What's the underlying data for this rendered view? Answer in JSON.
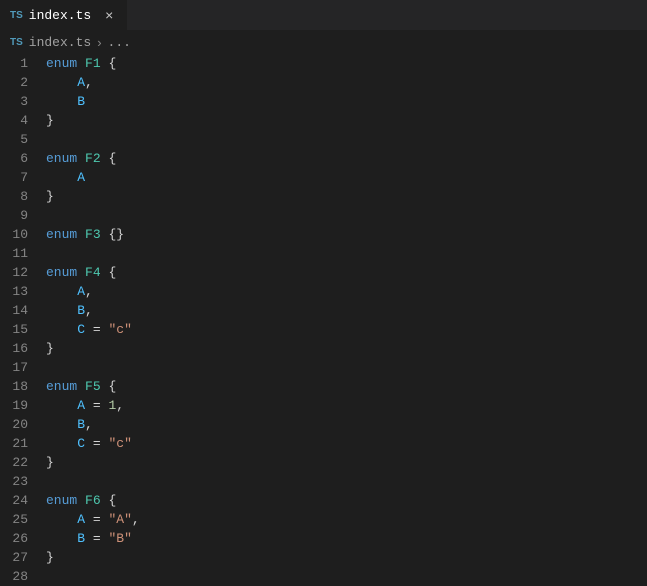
{
  "tab": {
    "icon": "TS",
    "filename": "index.ts",
    "close": "×"
  },
  "breadcrumb": {
    "icon": "TS",
    "filename": "index.ts",
    "sep": "›",
    "more": "..."
  },
  "code": {
    "lines": [
      {
        "n": "1",
        "t": [
          [
            "kw",
            "enum"
          ],
          [
            "sp",
            " "
          ],
          [
            "type",
            "F1"
          ],
          [
            "sp",
            " "
          ],
          [
            "punc",
            "{"
          ]
        ]
      },
      {
        "n": "2",
        "t": [
          [
            "indent",
            "    "
          ],
          [
            "member",
            "A"
          ],
          [
            "punc",
            ","
          ]
        ]
      },
      {
        "n": "3",
        "t": [
          [
            "indent",
            "    "
          ],
          [
            "member",
            "B"
          ]
        ]
      },
      {
        "n": "4",
        "t": [
          [
            "punc",
            "}"
          ]
        ]
      },
      {
        "n": "5",
        "t": []
      },
      {
        "n": "6",
        "t": [
          [
            "kw",
            "enum"
          ],
          [
            "sp",
            " "
          ],
          [
            "type",
            "F2"
          ],
          [
            "sp",
            " "
          ],
          [
            "punc",
            "{"
          ]
        ]
      },
      {
        "n": "7",
        "t": [
          [
            "indent",
            "    "
          ],
          [
            "member",
            "A"
          ]
        ]
      },
      {
        "n": "8",
        "t": [
          [
            "punc",
            "}"
          ]
        ]
      },
      {
        "n": "9",
        "t": []
      },
      {
        "n": "10",
        "t": [
          [
            "kw",
            "enum"
          ],
          [
            "sp",
            " "
          ],
          [
            "type",
            "F3"
          ],
          [
            "sp",
            " "
          ],
          [
            "punc",
            "{}"
          ]
        ]
      },
      {
        "n": "11",
        "t": []
      },
      {
        "n": "12",
        "t": [
          [
            "kw",
            "enum"
          ],
          [
            "sp",
            " "
          ],
          [
            "type",
            "F4"
          ],
          [
            "sp",
            " "
          ],
          [
            "punc",
            "{"
          ]
        ]
      },
      {
        "n": "13",
        "t": [
          [
            "indent",
            "    "
          ],
          [
            "member",
            "A"
          ],
          [
            "punc",
            ","
          ]
        ]
      },
      {
        "n": "14",
        "t": [
          [
            "indent",
            "    "
          ],
          [
            "member",
            "B"
          ],
          [
            "punc",
            ","
          ]
        ]
      },
      {
        "n": "15",
        "t": [
          [
            "indent",
            "    "
          ],
          [
            "member",
            "C"
          ],
          [
            "sp",
            " "
          ],
          [
            "punc",
            "="
          ],
          [
            "sp",
            " "
          ],
          [
            "str",
            "\"c\""
          ]
        ]
      },
      {
        "n": "16",
        "t": [
          [
            "punc",
            "}"
          ]
        ]
      },
      {
        "n": "17",
        "t": []
      },
      {
        "n": "18",
        "t": [
          [
            "kw",
            "enum"
          ],
          [
            "sp",
            " "
          ],
          [
            "type",
            "F5"
          ],
          [
            "sp",
            " "
          ],
          [
            "punc",
            "{"
          ]
        ]
      },
      {
        "n": "19",
        "t": [
          [
            "indent",
            "    "
          ],
          [
            "member",
            "A"
          ],
          [
            "sp",
            " "
          ],
          [
            "punc",
            "="
          ],
          [
            "sp",
            " "
          ],
          [
            "num",
            "1"
          ],
          [
            "punc",
            ","
          ]
        ]
      },
      {
        "n": "20",
        "t": [
          [
            "indent",
            "    "
          ],
          [
            "member",
            "B"
          ],
          [
            "punc",
            ","
          ]
        ]
      },
      {
        "n": "21",
        "t": [
          [
            "indent",
            "    "
          ],
          [
            "member",
            "C"
          ],
          [
            "sp",
            " "
          ],
          [
            "punc",
            "="
          ],
          [
            "sp",
            " "
          ],
          [
            "str",
            "\"c\""
          ]
        ]
      },
      {
        "n": "22",
        "t": [
          [
            "punc",
            "}"
          ]
        ]
      },
      {
        "n": "23",
        "t": []
      },
      {
        "n": "24",
        "t": [
          [
            "kw",
            "enum"
          ],
          [
            "sp",
            " "
          ],
          [
            "type",
            "F6"
          ],
          [
            "sp",
            " "
          ],
          [
            "punc",
            "{"
          ]
        ]
      },
      {
        "n": "25",
        "t": [
          [
            "indent",
            "    "
          ],
          [
            "member",
            "A"
          ],
          [
            "sp",
            " "
          ],
          [
            "punc",
            "="
          ],
          [
            "sp",
            " "
          ],
          [
            "str",
            "\"A\""
          ],
          [
            "punc",
            ","
          ]
        ]
      },
      {
        "n": "26",
        "t": [
          [
            "indent",
            "    "
          ],
          [
            "member",
            "B"
          ],
          [
            "sp",
            " "
          ],
          [
            "punc",
            "="
          ],
          [
            "sp",
            " "
          ],
          [
            "str",
            "\"B\""
          ]
        ]
      },
      {
        "n": "27",
        "t": [
          [
            "punc",
            "}"
          ]
        ]
      },
      {
        "n": "28",
        "t": []
      }
    ]
  },
  "colors": {
    "background": "#1e1e1e",
    "tabbar": "#252526",
    "keyword": "#569cd6",
    "type": "#4ec9b0",
    "member": "#4fc1ff",
    "string": "#ce9178",
    "number": "#b5cea8",
    "gutter": "#858585"
  }
}
